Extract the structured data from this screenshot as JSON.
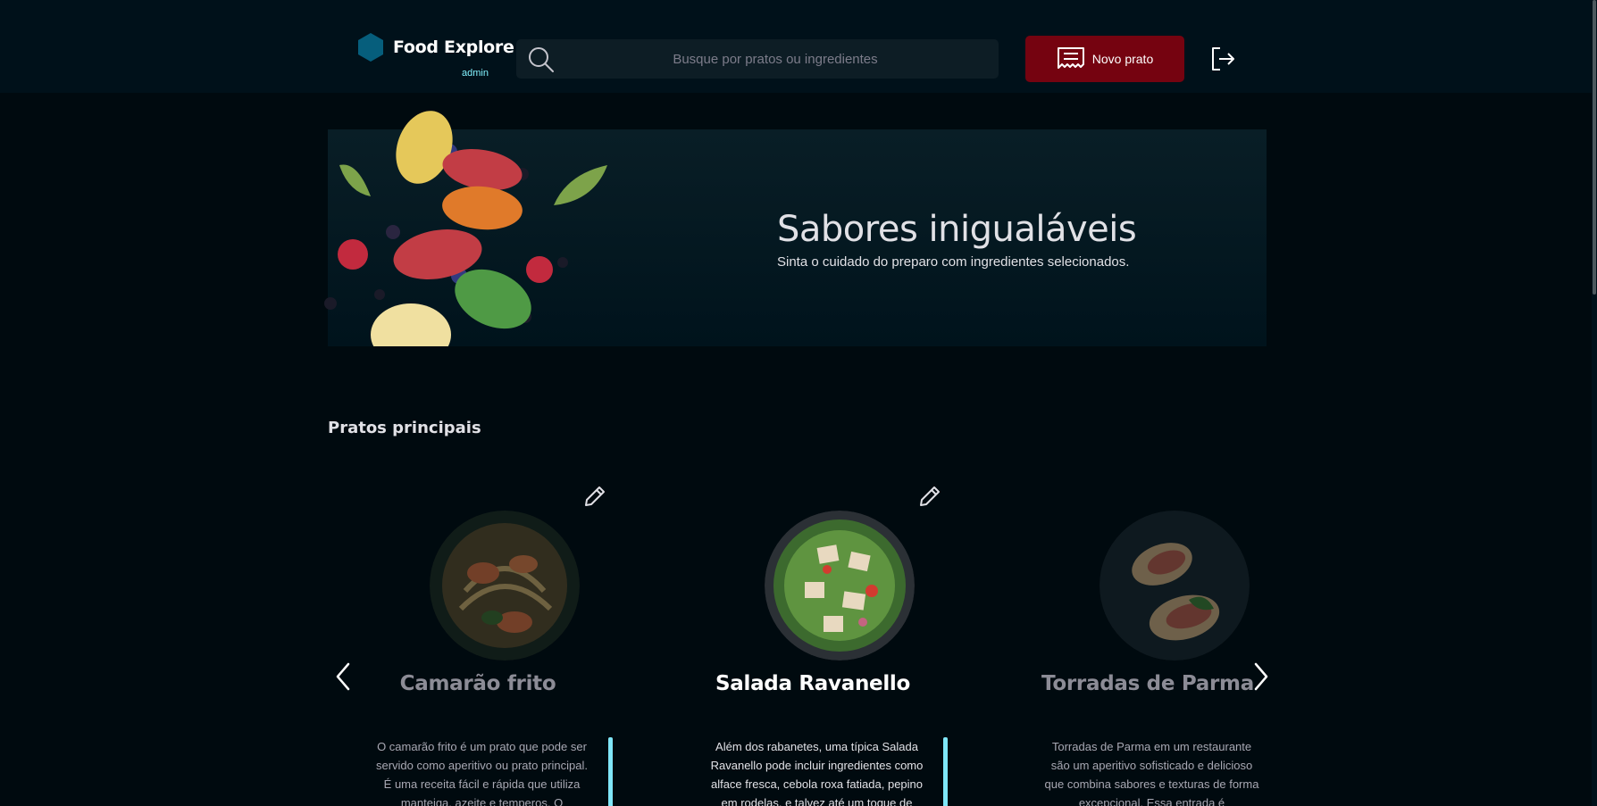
{
  "header": {
    "brand": "Food Explore",
    "role": "admin",
    "search_placeholder": "Busque por pratos ou ingredientes",
    "new_dish_label": "Novo prato"
  },
  "banner": {
    "title": "Sabores inigualáveis",
    "subtitle": "Sinta o cuidado do preparo com ingredientes selecionados."
  },
  "section": {
    "title": "Pratos principais"
  },
  "dishes": [
    {
      "name": "Camarão frito",
      "description": "O camarão frito é um prato que pode ser servido como aperitivo ou prato principal. É uma receita fácil e rápida que utiliza manteiga, azeite e temperos. O"
    },
    {
      "name": "Salada Ravanello",
      "description": "Além dos rabanetes, uma típica Salada Ravanello pode incluir ingredientes como alface fresca, cebola roxa fatiada, pepino em rodelas, e talvez até um toque de"
    },
    {
      "name": "Torradas de Parma",
      "description": "Torradas de Parma em um restaurante são um aperitivo sofisticado e delicioso que combina sabores e texturas de forma excepcional. Essa entrada é"
    }
  ],
  "colors": {
    "background": "#000a0f",
    "header": "#00111a",
    "accent_button": "#750310",
    "brand_icon": "#065e7c",
    "admin_text": "#82f3ff"
  }
}
